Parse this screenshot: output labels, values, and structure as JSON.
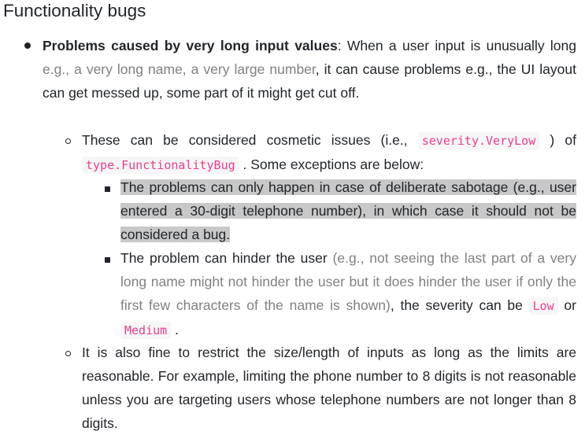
{
  "heading": "Functionality bugs",
  "item1": {
    "bold": "Problems caused by very long input values",
    "t1": ": When a user input is unusually long ",
    "muted": "e.g., a very long name, a very large number",
    "t2": ", it can cause problems e.g., the UI layout can get messed up, some part of it might get cut off."
  },
  "sub1": {
    "t1": "These can be considered cosmetic issues (i.e., ",
    "code1": "severity.VeryLow",
    "t2": " ) of ",
    "code2": "type.FunctionalityBug",
    "t3": " . Some exceptions are below:"
  },
  "ex1": {
    "text": "The problems can only happen in case of deliberate sabotage (e.g., user entered a 30-digit telephone number), in which case it should not be considered a bug."
  },
  "ex2": {
    "t1": "The problem can hinder the user ",
    "muted": "(e.g., not seeing the last part of a very long name might not hinder the user but it does hinder the user if only the first few characters of the name is shown)",
    "t2": ", the severity can be ",
    "code1": "Low",
    "t3": " or ",
    "code2": "Medium",
    "t4": " ."
  },
  "sub2": {
    "text": "It is also fine to restrict the size/length of inputs as long as the limits are reasonable. For example, limiting the phone number to 8 digits is not reasonable unless you are targeting users whose telephone numbers are not longer than 8 digits."
  }
}
